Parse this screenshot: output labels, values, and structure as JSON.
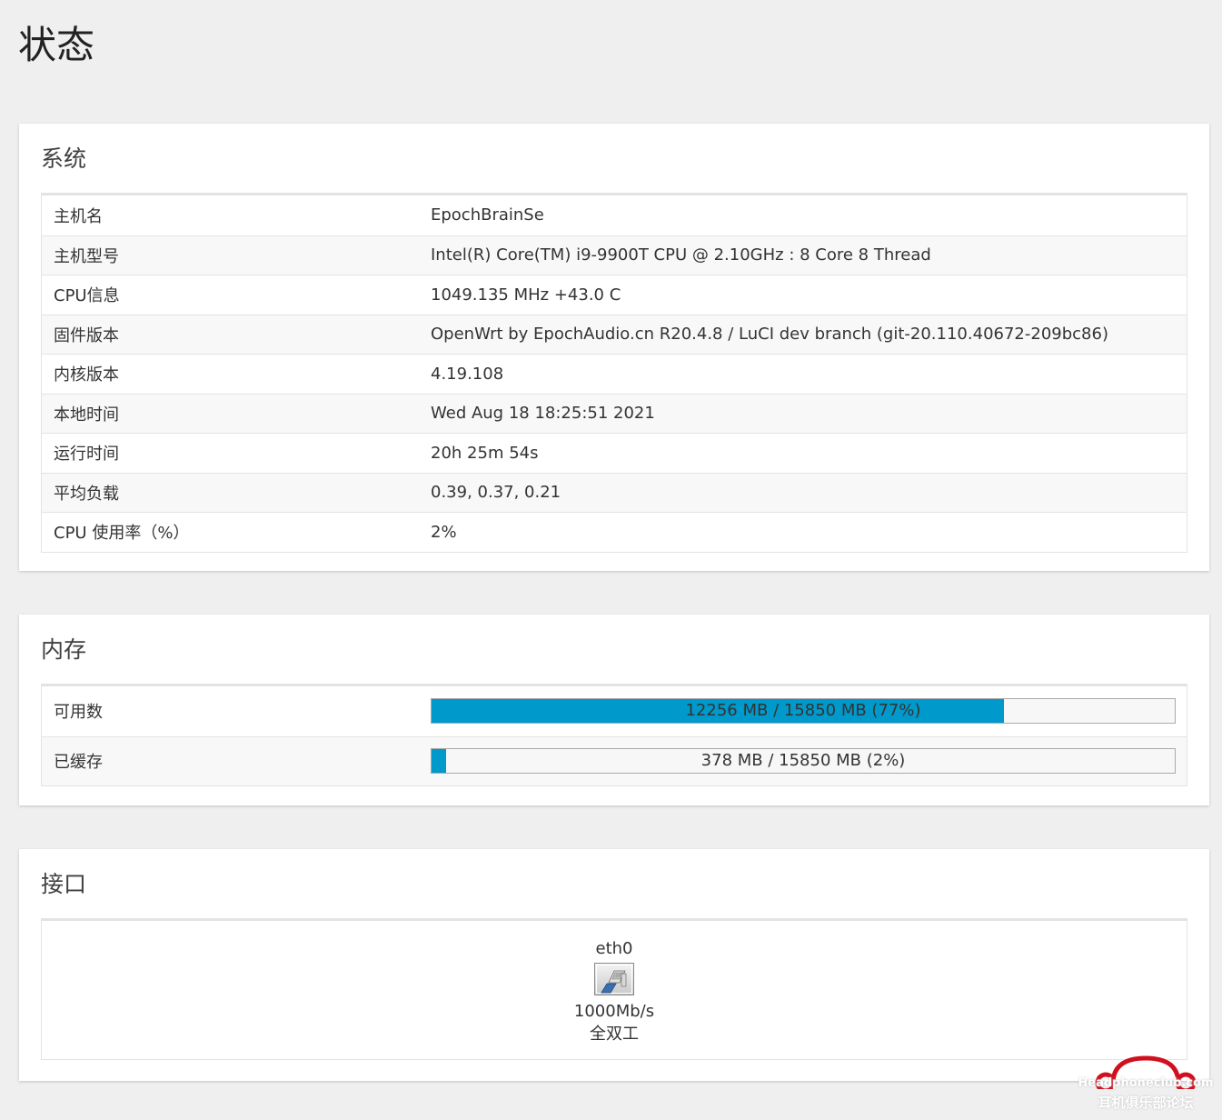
{
  "page": {
    "title": "状态"
  },
  "system": {
    "title": "系统",
    "rows": [
      {
        "label": "主机名",
        "value": "EpochBrainSe"
      },
      {
        "label": "主机型号",
        "value": "Intel(R) Core(TM) i9-9900T CPU @ 2.10GHz : 8 Core 8 Thread"
      },
      {
        "label": "CPU信息",
        "value": "1049.135 MHz +43.0 C"
      },
      {
        "label": "固件版本",
        "value": "OpenWrt by EpochAudio.cn R20.4.8 / LuCI dev branch (git-20.110.40672-209bc86)"
      },
      {
        "label": "内核版本",
        "value": "4.19.108"
      },
      {
        "label": "本地时间",
        "value": "Wed Aug 18 18:25:51 2021"
      },
      {
        "label": "运行时间",
        "value": "20h 25m 54s"
      },
      {
        "label": "平均负载",
        "value": "0.39, 0.37, 0.21"
      },
      {
        "label": "CPU 使用率（%）",
        "value": "2%"
      }
    ]
  },
  "memory": {
    "title": "内存",
    "rows": [
      {
        "label": "可用数",
        "text": "12256 MB / 15850 MB (77%)",
        "percent": 77
      },
      {
        "label": "已缓存",
        "text": "378 MB / 15850 MB (2%)",
        "percent": 2
      }
    ],
    "bar_color": "#0099cc"
  },
  "interfaces": {
    "title": "接口",
    "items": [
      {
        "name": "eth0",
        "speed": "1000Mb/s",
        "duplex": "全双工",
        "icon": "ethernet-port-icon"
      }
    ]
  },
  "watermark": {
    "top": "Headphoneclub.com",
    "bottom": "耳机俱乐部论坛",
    "icon": "headphone-logo-icon"
  }
}
